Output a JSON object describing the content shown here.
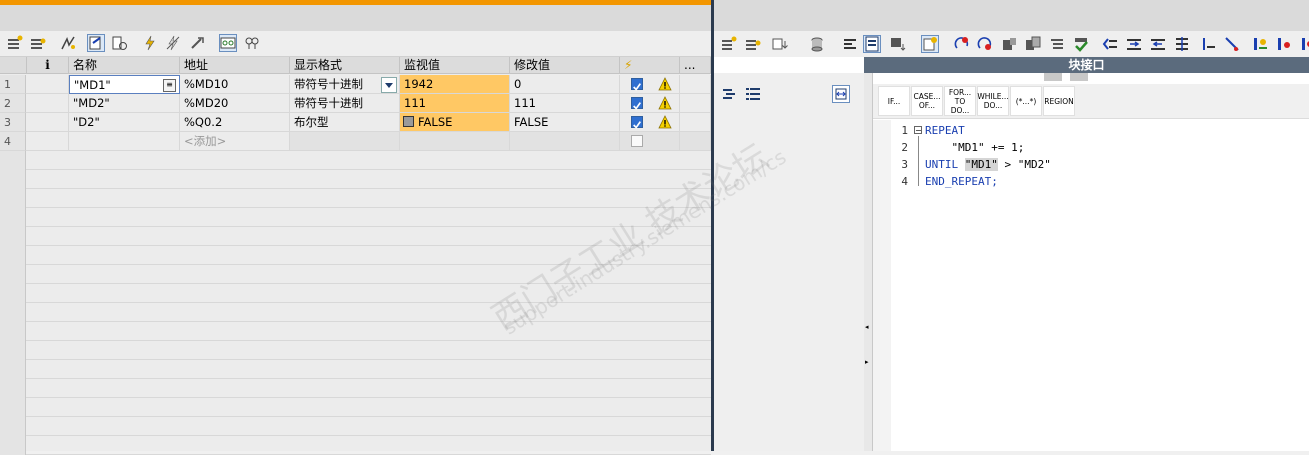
{
  "watch_table": {
    "columns": {
      "info": "i",
      "name": "名称",
      "address": "地址",
      "format": "显示格式",
      "monitor": "监视值",
      "modify": "修改值",
      "force": "⚡",
      "more": "..."
    },
    "rows": [
      {
        "no": "1",
        "name": "\"MD1\"",
        "address": "%MD10",
        "format": "带符号十进制",
        "monitor": "1942",
        "modify": "0",
        "checked": true,
        "warn": true
      },
      {
        "no": "2",
        "name": "\"MD2\"",
        "address": "%MD20",
        "format": "带符号十进制",
        "monitor": "111",
        "modify": "111",
        "checked": true,
        "warn": true
      },
      {
        "no": "3",
        "name": "\"D2\"",
        "address": "%Q0.2",
        "format": "布尔型",
        "monitor": "FALSE",
        "modify": "FALSE",
        "checked": true,
        "warn": true
      },
      {
        "no": "4",
        "name": "",
        "address": "<添加>",
        "format": "",
        "monitor": "",
        "modify": "",
        "checked": false,
        "warn": false
      }
    ]
  },
  "editor": {
    "block_title": "块接口",
    "instructions": [
      "IF...",
      "CASE... OF...",
      "FOR... TO DO...",
      "WHILE... DO...",
      "(*...*)",
      "REGION"
    ],
    "lines": [
      {
        "no": "1",
        "text": "REPEAT"
      },
      {
        "no": "2",
        "text": "    \"MD1\" += 1;"
      },
      {
        "no": "3",
        "text": "UNTIL \"MD1\" > \"MD2\""
      },
      {
        "no": "4",
        "text": "END_REPEAT;"
      }
    ]
  },
  "watermark": {
    "line1": "西门子工业  技术论坛",
    "line2": "support.industry.siemens.com/cs"
  },
  "colors": {
    "accent": "#f39600",
    "monitor_bg": "#ffc864",
    "block_header": "#5b6b7d",
    "keyword": "#1a3fb0"
  }
}
